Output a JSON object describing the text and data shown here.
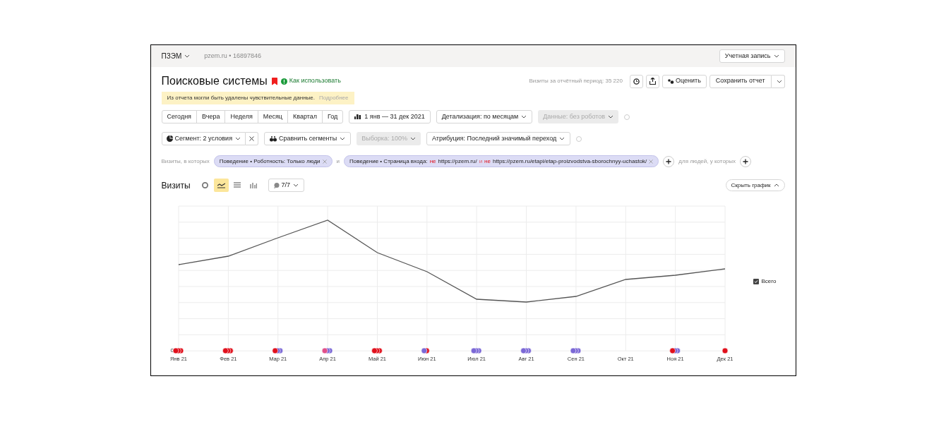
{
  "header": {
    "counter": "ПЗЭМ",
    "site": "pzem.ru • 16897846",
    "account": "Учетная запись"
  },
  "report": {
    "title": "Поисковые системы",
    "bookmarked": true,
    "help_link": "Как использовать",
    "visits_total": "Визиты за отчётный период: 35 220",
    "rate_button": "Оценить",
    "save_button": "Сохранить отчет"
  },
  "notice": {
    "text": "Из отчета могли быть удалены чувствительные данные.",
    "link": "Подробнее"
  },
  "periods": [
    "Сегодня",
    "Вчера",
    "Неделя",
    "Месяц",
    "Квартал",
    "Год"
  ],
  "date_range": "1 янв — 31 дек 2021",
  "detail": "Детализация: по месяцам",
  "data_filter": {
    "label": "Данные: без роботов",
    "disabled": true
  },
  "segment": "Сегмент: 2 условия",
  "compare": "Сравнить сегменты",
  "sample": {
    "label": "Выборка: 100%",
    "disabled": true
  },
  "attribution": "Атрибуция: Последний значимый переход",
  "filters": {
    "prefix": "Визиты, в которых",
    "joiner": "и",
    "suffix": "для людей, у которых",
    "chips": [
      {
        "parts": [
          {
            "kind": "plain",
            "text": "Поведение • Роботность: Только люди"
          }
        ]
      },
      {
        "parts": [
          {
            "kind": "plain",
            "text": "Поведение • Страница входа:"
          },
          {
            "kind": "negation",
            "text": "не"
          },
          {
            "kind": "plain",
            "text": "https://pzem.ru/"
          },
          {
            "kind": "joiner",
            "text": "и"
          },
          {
            "kind": "negation",
            "text": "не"
          },
          {
            "kind": "plain",
            "text": "https://pzem.ru/etapi/etap-proizvodstva-sborochnyy-uchastok/"
          }
        ]
      }
    ]
  },
  "chart_toolbar": {
    "title": "Визиты",
    "views": [
      {
        "kind": "pie",
        "selected": false
      },
      {
        "kind": "line",
        "selected": true
      },
      {
        "kind": "stacked",
        "selected": false
      },
      {
        "kind": "bars",
        "selected": false
      }
    ],
    "notes": "7/7",
    "hide_button": "Скрыть график"
  },
  "chart": {
    "zero_label": "0",
    "legend": [
      {
        "label": "Всего",
        "checked": true
      }
    ],
    "months": [
      {
        "label": "Янв 21",
        "markers": [
          {
            "color": "#e0101c"
          },
          {
            "color": "#e0101c"
          },
          {
            "color": "#e0101c"
          }
        ]
      },
      {
        "label": "Фев 21",
        "markers": [
          {
            "color": "#e0101c"
          },
          {
            "color": "#e0101c"
          },
          {
            "color": "#e0101c"
          }
        ]
      },
      {
        "label": "Мар 21",
        "markers": [
          {
            "color": "#e0101c"
          },
          {
            "color": "#7b68d6"
          },
          {
            "color": "#7b68d6"
          }
        ]
      },
      {
        "label": "Апр 21",
        "markers": [
          {
            "color": "#e0508a"
          },
          {
            "color": "#7b68d6"
          },
          {
            "color": "#7b68d6"
          }
        ]
      },
      {
        "label": "Май 21",
        "markers": [
          {
            "color": "#e0101c"
          },
          {
            "color": "#e0101c"
          },
          {
            "color": "#e0101c"
          }
        ]
      },
      {
        "label": "Июн 21",
        "markers": [
          {
            "color": "#7b68d6"
          },
          {
            "color": "#e0101c"
          }
        ]
      },
      {
        "label": "Июл 21",
        "markers": [
          {
            "color": "#7b68d6"
          },
          {
            "color": "#7b68d6"
          },
          {
            "color": "#7b68d6"
          }
        ]
      },
      {
        "label": "Авг 21",
        "markers": [
          {
            "color": "#7b68d6"
          },
          {
            "color": "#7b68d6"
          },
          {
            "color": "#7b68d6"
          }
        ]
      },
      {
        "label": "Сен 21",
        "markers": [
          {
            "color": "#7b68d6"
          },
          {
            "color": "#7b68d6"
          },
          {
            "color": "#7b68d6"
          }
        ]
      },
      {
        "label": "Окт 21"
      },
      {
        "label": "Ноя 21",
        "markers": [
          {
            "color": "#e0101c"
          },
          {
            "color": "#7b68d6"
          },
          {
            "color": "#7b68d6"
          }
        ]
      },
      {
        "label": "Дек 21",
        "markers": [
          {
            "color": "#e0101c"
          }
        ]
      }
    ]
  }
}
